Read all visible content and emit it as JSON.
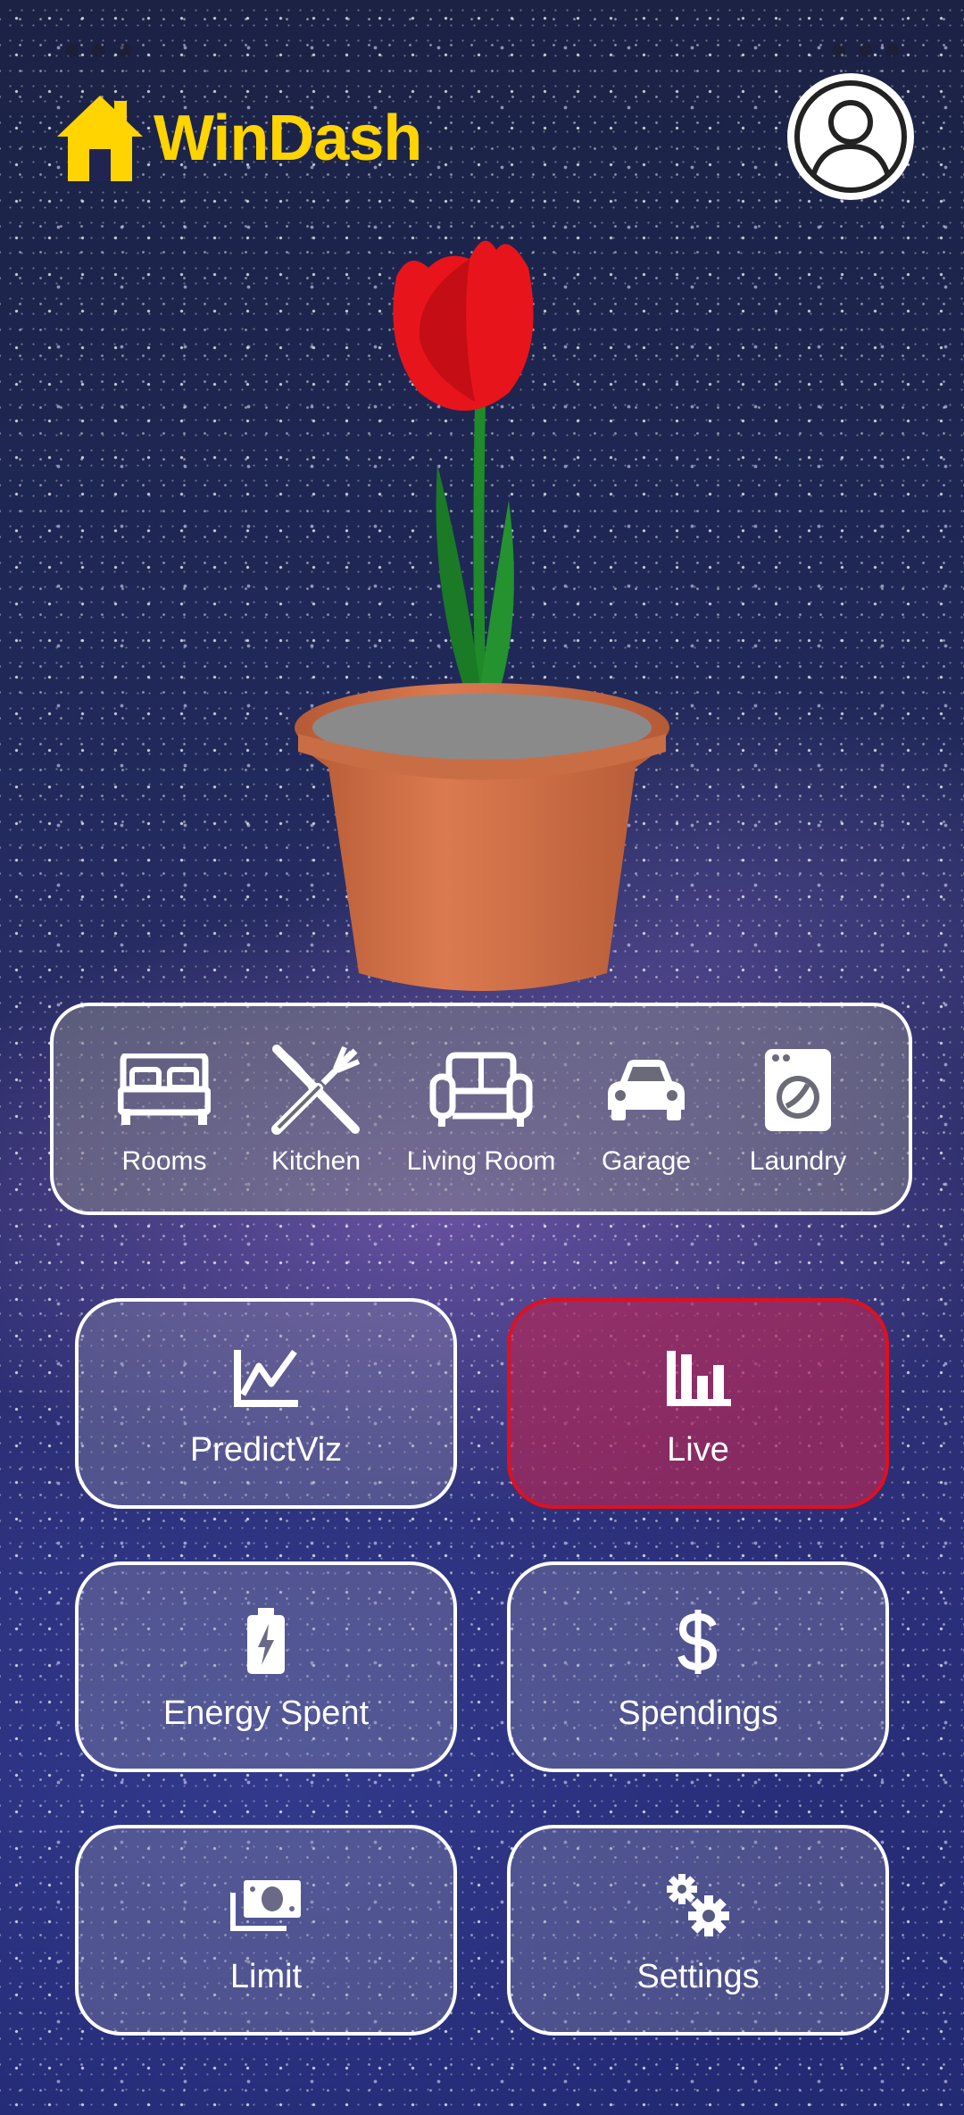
{
  "app": {
    "title": "WinDash"
  },
  "rooms": [
    {
      "label": "Rooms",
      "icon": "bed-icon"
    },
    {
      "label": "Kitchen",
      "icon": "utensils-icon"
    },
    {
      "label": "Living Room",
      "icon": "sofa-icon"
    },
    {
      "label": "Garage",
      "icon": "car-icon"
    },
    {
      "label": "Laundry",
      "icon": "washing-machine-icon"
    }
  ],
  "tiles": [
    {
      "label": "PredictViz",
      "icon": "line-chart-icon",
      "active": false
    },
    {
      "label": "Live",
      "icon": "bar-chart-icon",
      "active": true
    },
    {
      "label": "Energy Spent",
      "icon": "battery-charging-icon",
      "active": false
    },
    {
      "label": "Spendings",
      "icon": "dollar-icon",
      "active": false
    },
    {
      "label": "Limit",
      "icon": "money-icon",
      "active": false
    },
    {
      "label": "Settings",
      "icon": "gears-icon",
      "active": false
    }
  ],
  "colors": {
    "brand": "#ffd400",
    "active_border": "#e0101e"
  }
}
